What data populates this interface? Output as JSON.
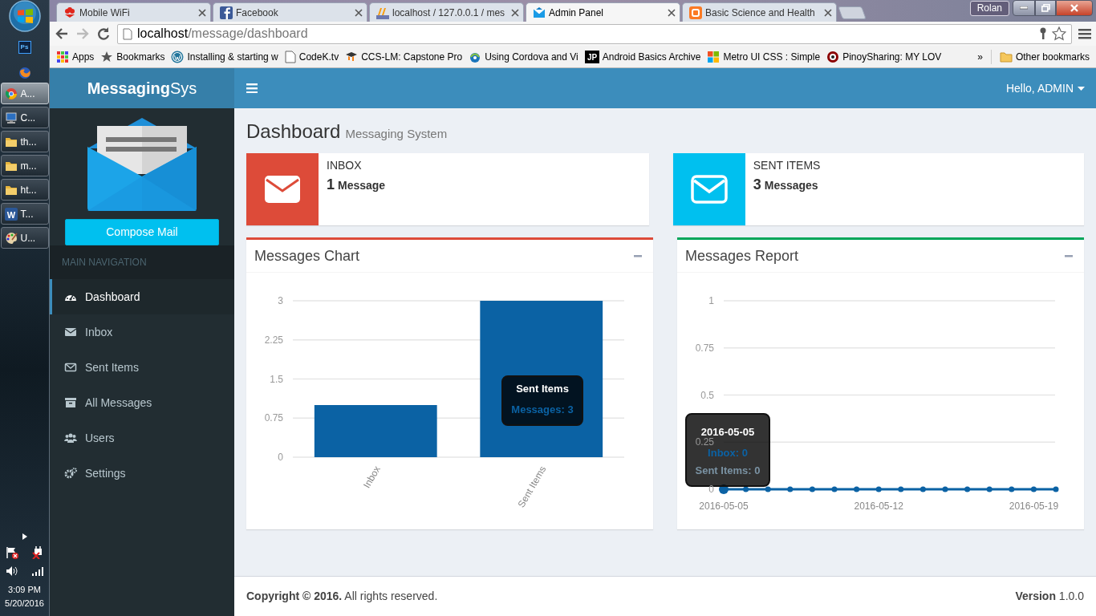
{
  "taskbar": {
    "pinned_label": "Ps",
    "buttons": [
      {
        "label": "A...",
        "selected": true
      },
      {
        "label": "C...",
        "selected": false
      },
      {
        "label": "th...",
        "selected": false
      },
      {
        "label": "m...",
        "selected": false
      },
      {
        "label": "ht...",
        "selected": false
      },
      {
        "label": "T...",
        "selected": false,
        "icon_text": "W"
      },
      {
        "label": "U...",
        "selected": false
      }
    ],
    "clock": {
      "time": "3:09 PM",
      "date": "5/20/2016"
    }
  },
  "browser": {
    "tabs": [
      {
        "title": "Mobile WiFi",
        "selected": false
      },
      {
        "title": "Facebook",
        "selected": false
      },
      {
        "title": "localhost / 127.0.0.1 / mes",
        "selected": false
      },
      {
        "title": "Admin Panel",
        "selected": true
      },
      {
        "title": "Basic Science and Health",
        "selected": false
      }
    ],
    "profile": "Rolan",
    "address": {
      "host": "localhost",
      "path": "/message/dashboard"
    },
    "bookmarks": [
      {
        "label": "Apps"
      },
      {
        "label": "Bookmarks"
      },
      {
        "label": "Installing & starting w"
      },
      {
        "label": "CodeK.tv"
      },
      {
        "label": "CCS-LM: Capstone Pro"
      },
      {
        "label": "Using Cordova and Vi"
      },
      {
        "label": "Android Basics Archive",
        "icon_text": "JP"
      },
      {
        "label": "Metro UI CSS : Simple"
      },
      {
        "label": "PinoySharing: MY LOV"
      }
    ],
    "bookmarks_overflow": "»",
    "other_bookmarks": "Other bookmarks"
  },
  "app": {
    "brand": "**Messaging**Sys",
    "user": "Hello, ADMIN",
    "compose": "Compose Mail",
    "nav_header": "MAIN NAVIGATION",
    "nav": [
      {
        "label": "Dashboard",
        "selected": true
      },
      {
        "label": "Inbox",
        "selected": false
      },
      {
        "label": "Sent Items",
        "selected": false
      },
      {
        "label": "All Messages",
        "selected": false
      },
      {
        "label": "Users",
        "selected": false
      },
      {
        "label": "Settings",
        "selected": false
      }
    ],
    "page_title": "Dashboard",
    "page_subtitle": "Messaging System",
    "info_boxes": [
      {
        "label": "INBOX",
        "count": "1",
        "unit": "Message",
        "color": "#dd4b39"
      },
      {
        "label": "SENT ITEMS",
        "count": "3",
        "unit": "Messages",
        "color": "#00c0ef"
      }
    ],
    "panels": [
      {
        "title": "Messages Chart",
        "color": "#dd4b39",
        "chart_data": {
          "type": "bar",
          "categories": [
            "Inbox",
            "Sent Items"
          ],
          "series": [
            {
              "color": "#0b62a4",
              "values": [
                1,
                3
              ]
            }
          ],
          "ylim": [
            0,
            3
          ],
          "yticks": [
            0,
            0.75,
            1.5,
            2.25,
            3
          ],
          "grid": true
        },
        "tooltip": {
          "title": "Sent Items",
          "lines": [
            {
              "text": "Messages: 3",
              "color": "#0b62a4"
            }
          ]
        }
      },
      {
        "title": "Messages Report",
        "color": "#00a65a",
        "chart_data": {
          "type": "line",
          "x": [
            "2016-05-05",
            "2016-05-06",
            "2016-05-07",
            "2016-05-08",
            "2016-05-09",
            "2016-05-10",
            "2016-05-11",
            "2016-05-12",
            "2016-05-13",
            "2016-05-14",
            "2016-05-15",
            "2016-05-16",
            "2016-05-17",
            "2016-05-18",
            "2016-05-19",
            "2016-05-20"
          ],
          "series": [
            {
              "color": "#0b62a4",
              "marker": "circle",
              "values": [
                0,
                0,
                0,
                0,
                0,
                0,
                0,
                0,
                0,
                0,
                0,
                0,
                0,
                0,
                0,
                0
              ]
            }
          ],
          "xlim": [
            "2016-05-05",
            "2016-05-20"
          ],
          "ylim": [
            0,
            1
          ],
          "yticks": [
            0,
            0.25,
            0.5,
            0.75,
            1
          ],
          "grid": true,
          "xticks": [
            {
              "value": "2016-05-05",
              "label": "2016-05-05"
            },
            {
              "value": "2016-05-12",
              "label": "2016-05-12"
            },
            {
              "value": "2016-05-19",
              "label": "2016-05-19"
            }
          ]
        },
        "tooltip": {
          "title": "2016-05-05",
          "lines": [
            {
              "text": "Inbox: 0",
              "color": "#0b62a4"
            },
            {
              "text": "Sent Items: 0",
              "color": "#7a92a3"
            }
          ]
        }
      }
    ],
    "footer_left": "**Copyright © 2016.** All rights reserved.",
    "footer_right": "**Version** 1.0.0"
  }
}
